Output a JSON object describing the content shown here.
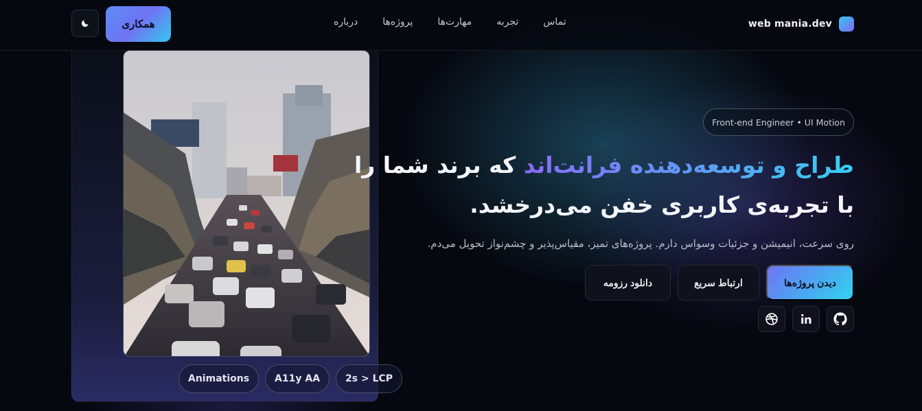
{
  "header": {
    "brand": "web mania.dev",
    "nav": [
      "درباره",
      "پروژه‌ها",
      "مهارت‌ها",
      "تجربه",
      "تماس"
    ],
    "collab_button": "همکاری",
    "theme_icon": "moon-icon"
  },
  "hero": {
    "role_pill": "Front-end Engineer • UI Motion",
    "headline_highlight": "طراح و توسعه‌دهنده فرانت‌اند",
    "headline_rest": " که برند شما را",
    "headline_line2": "با تجربه‌ی کاربری خفن می‌درخشد.",
    "subtitle": "روی سرعت، انیمیشن و جزئیات وسواس دارم. پروژه‌های تمیز، مقیاس‌پذیر و چشم‌نواز تحویل می‌دم.",
    "buttons": {
      "projects": "دیدن پروژه‌ها",
      "contact": "ارتباط سریع",
      "resume": "دانلود رزومه"
    },
    "socials": [
      "github-icon",
      "linkedin-icon",
      "dribbble-icon"
    ]
  },
  "card": {
    "photo": "city-traffic-photo",
    "chips": [
      "Animations",
      "A11y AA",
      "2s > LCP"
    ]
  },
  "colors": {
    "background": "#06080f",
    "accent_cyan": "#34c7f0",
    "accent_violet": "#6f74f2"
  }
}
